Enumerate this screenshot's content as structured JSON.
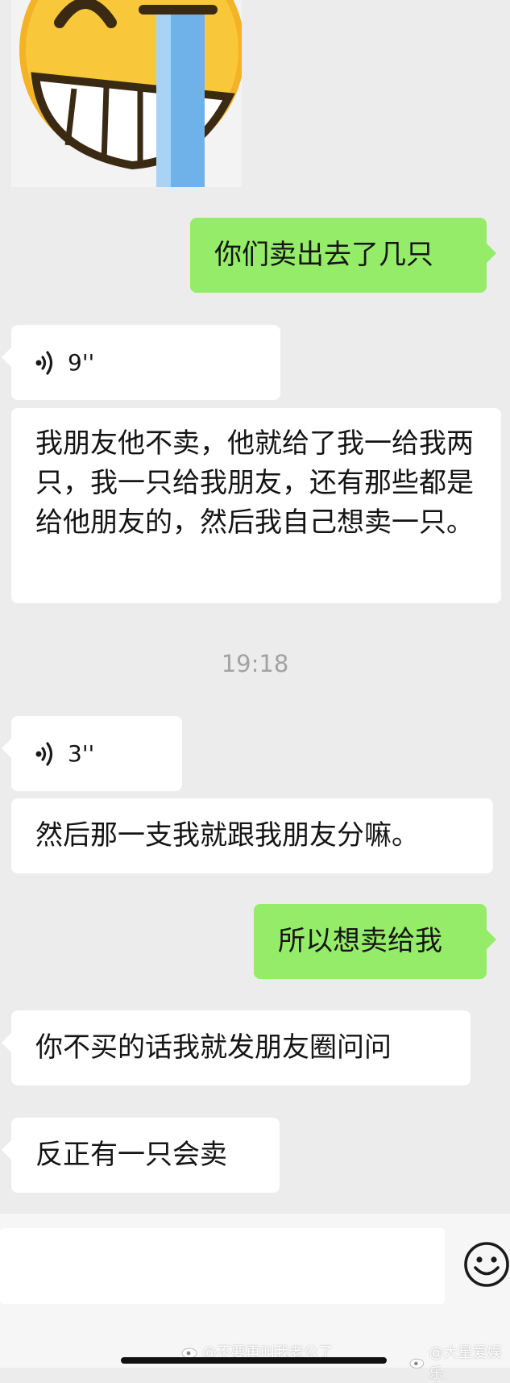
{
  "messages": {
    "m1": "你们卖出去了几只",
    "voice1_duration": "9''",
    "m2": "我朋友他不卖，他就给了我一给我两只，我一只给我朋友，还有那些都是给他朋友的，然后我自己想卖一只。",
    "time1": "19:18",
    "voice2_duration": "3''",
    "m3": "然后那一支我就跟我朋友分嘛。",
    "m4": "所以想卖给我",
    "m5": "你不买的话我就发朋友圈问问",
    "m6": "反正有一只会卖"
  },
  "watermark": {
    "left": "@不要再叫我老公了",
    "right": "@大星爱娱乐"
  },
  "colors": {
    "background": "#ececec",
    "incoming_bubble": "#ffffff",
    "outgoing_bubble": "#95ec69"
  },
  "icons": [
    "cry-laugh-sticker",
    "voice-wave-icon",
    "emoji-icon",
    "weibo-icon"
  ]
}
